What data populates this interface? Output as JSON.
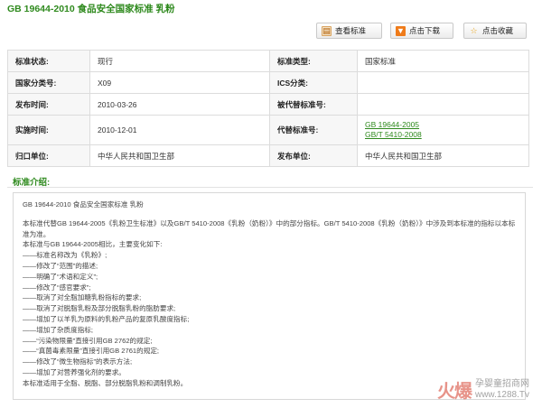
{
  "page": {
    "title": "GB 19644-2010 食品安全国家标准 乳粉"
  },
  "actions": {
    "view": "查看标准",
    "download": "点击下载",
    "favorite": "点击收藏"
  },
  "info": {
    "rows": [
      {
        "l1": "标准状态:",
        "v1": "现行",
        "l2": "标准类型:",
        "v2": "国家标准"
      },
      {
        "l1": "国家分类号:",
        "v1": "X09",
        "l2": "ICS分类:",
        "v2": ""
      },
      {
        "l1": "发布时间:",
        "v1": "2010-03-26",
        "l2": "被代替标准号:",
        "v2": ""
      },
      {
        "l1": "实施时间:",
        "v1": "2010-12-01",
        "l2": "代替标准号:",
        "v2": ""
      },
      {
        "l1": "归口单位:",
        "v1": "中华人民共和国卫生部",
        "l2": "发布单位:",
        "v2": "中华人民共和国卫生部"
      }
    ],
    "replaces": [
      "GB 19644-2005",
      "GB/T 5410-2008"
    ]
  },
  "intro": {
    "heading": "标准介绍:",
    "lines": [
      "GB 19644-2010 食品安全国家标准 乳粉",
      "",
      "本标准代替GB 19644-2005《乳粉卫生标准》以及GB/T 5410-2008《乳粉（奶粉）》中的部分指标。GB/T 5410-2008《乳粉（奶粉）》中涉及到本标准的指标以本标准为准。",
      "本标准与GB 19644-2005相比，主要变化如下:",
      "——标准名称改为《乳粉》;",
      "——修改了“范围”的描述;",
      "——明确了“术语和定义”;",
      "——修改了“感官要求”;",
      "——取消了对全脂加糖乳粉指标的要求;",
      "——取消了对脱脂乳粉及部分脱脂乳粉的脂肪要求;",
      "——增加了以羊乳为原料的乳粉产品的复原乳酸度指标;",
      "——增加了杂质度指标;",
      "——“污染物限量”直接引用GB 2762的规定;",
      "——“真菌毒素限量”直接引用GB 2761的规定;",
      "——修改了“微生物指标”的表示方法;",
      "——增加了对营养强化剂的要求。",
      "本标准适用于全脂、脱脂、部分脱脂乳粉和调制乳粉。"
    ]
  },
  "watermark": {
    "logo": "火爆",
    "site": "孕婴童招商网",
    "url": "www.1288.Tv"
  }
}
